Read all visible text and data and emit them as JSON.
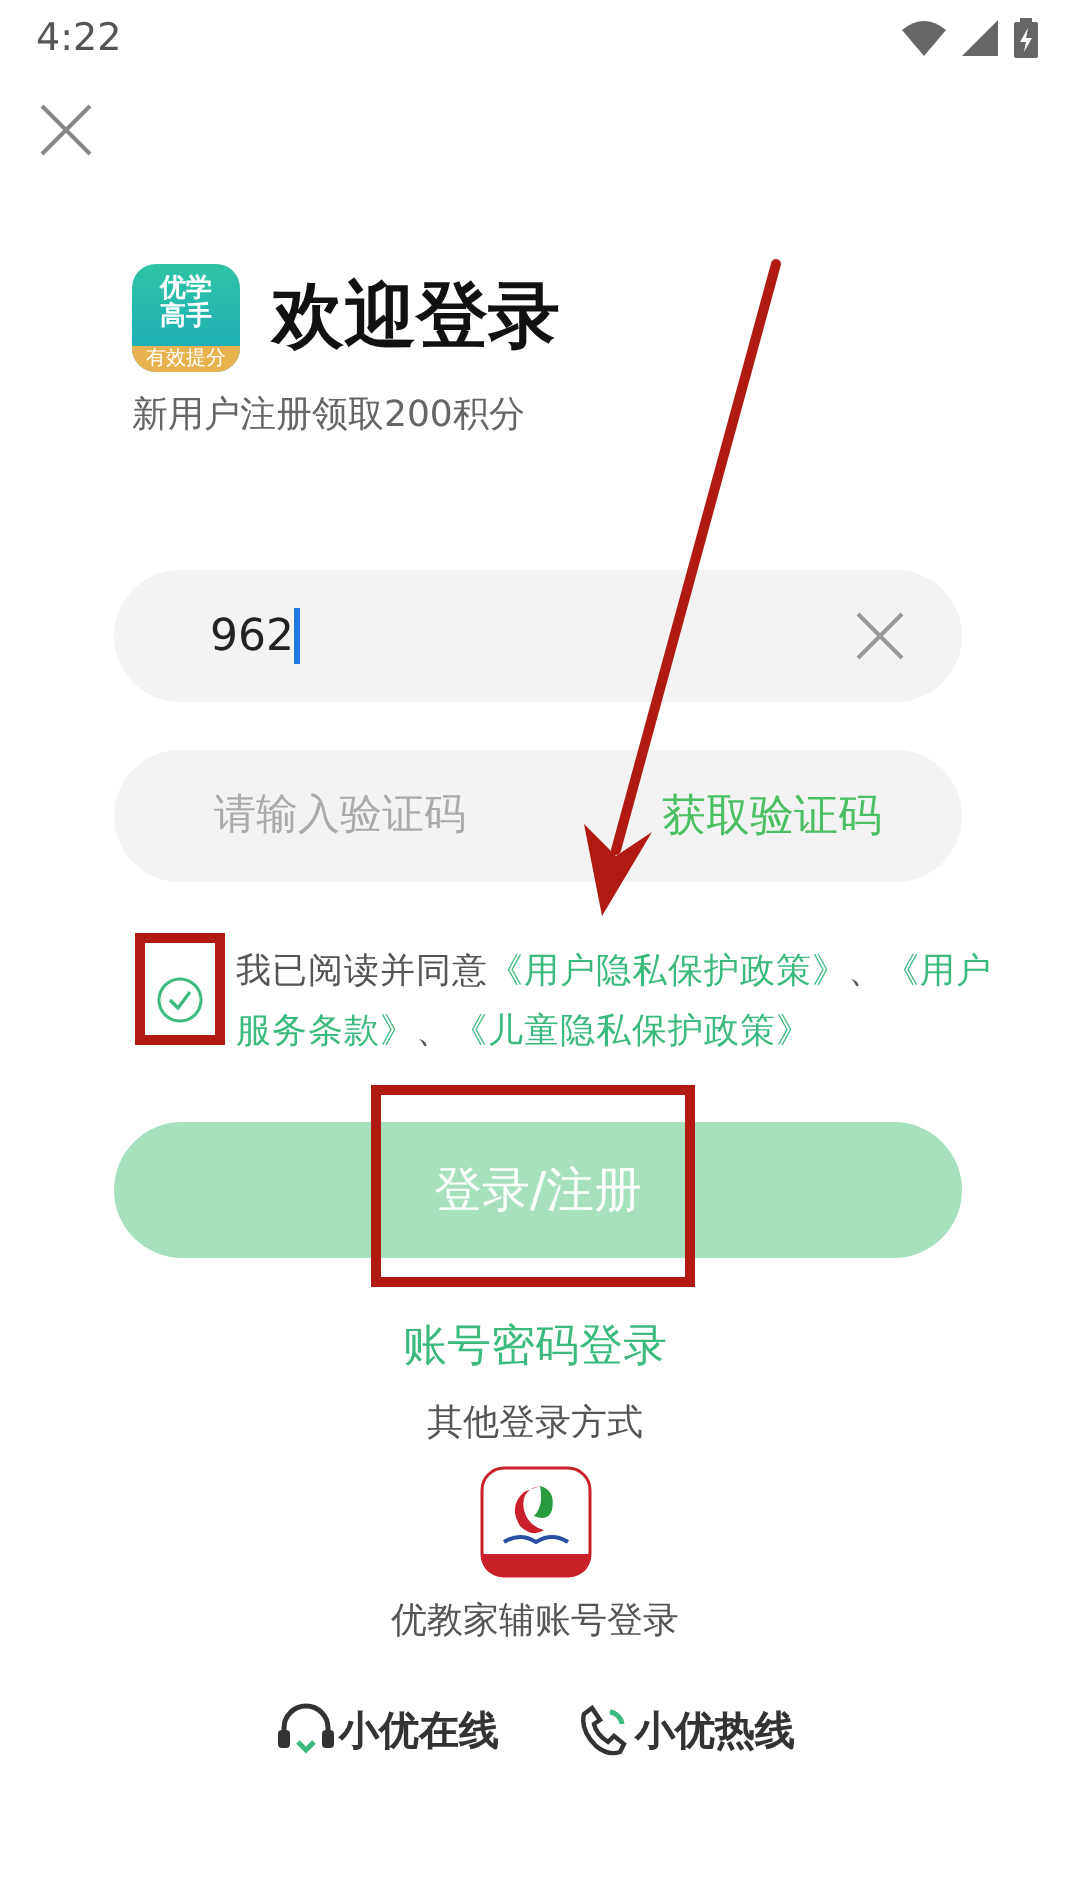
{
  "status_bar": {
    "time": "4:22"
  },
  "logo": {
    "lines": [
      "优学",
      "高手"
    ],
    "tagline": "有效提分"
  },
  "title": "欢迎登录",
  "subtitle": "新用户注册领取200积分",
  "phone_field": {
    "value": "962",
    "focused": true
  },
  "code_field": {
    "placeholder": "请输入验证码",
    "action": "获取验证码"
  },
  "agreement": {
    "checked": true,
    "parts": [
      {
        "text": "我已阅读并同意",
        "link": false
      },
      {
        "text": "《用户隐私保护政策》",
        "link": true
      },
      {
        "text": "、",
        "link": false
      },
      {
        "text": "《用户服务条款》",
        "link": true
      },
      {
        "text": "、",
        "link": false
      },
      {
        "text": "《儿童隐私保护政策》",
        "link": true
      }
    ]
  },
  "login_button": {
    "label": "登录/注册",
    "disabled": true
  },
  "password_login": "账号密码登录",
  "other_methods": {
    "heading": "其他登录方式",
    "items": [
      {
        "label": "优教家辅账号登录"
      }
    ]
  },
  "footer_links": [
    {
      "kind": "headset",
      "label": "小优在线"
    },
    {
      "kind": "phone",
      "label": "小优热线"
    }
  ]
}
